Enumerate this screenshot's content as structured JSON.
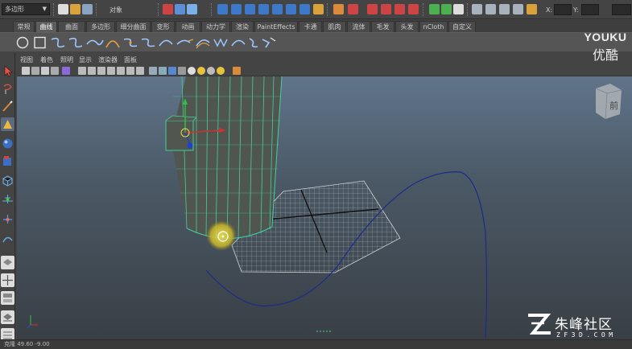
{
  "status_line": {
    "mode_menu": "多边形",
    "object_label": "对象",
    "coord_labels": {
      "x": "X:",
      "y": "Y:"
    },
    "colors": {
      "background": "#444444",
      "field": "#2b2b2b"
    }
  },
  "shelf": {
    "tabs": [
      {
        "label": "常规",
        "active": false
      },
      {
        "label": "曲线",
        "active": true
      },
      {
        "label": "曲面",
        "active": false
      },
      {
        "label": "多边形",
        "active": false
      },
      {
        "label": "细分曲面",
        "active": false
      },
      {
        "label": "变形",
        "active": false
      },
      {
        "label": "动画",
        "active": false
      },
      {
        "label": "动力学",
        "active": false
      },
      {
        "label": "渲染",
        "active": false
      },
      {
        "label": "PaintEffects",
        "active": false
      },
      {
        "label": "卡通",
        "active": false
      },
      {
        "label": "肌肉",
        "active": false
      },
      {
        "label": "流体",
        "active": false
      },
      {
        "label": "毛发",
        "active": false
      },
      {
        "label": "头发",
        "active": false
      },
      {
        "label": "nCloth",
        "active": false
      },
      {
        "label": "自定义",
        "active": false
      }
    ],
    "icons": [
      "circle-curve-icon",
      "square-curve-icon",
      "cv-curve-icon",
      "ep-curve-icon",
      "pencil-curve-icon",
      "arc-tool-icon",
      "attach-curves-icon",
      "detach-curves-icon",
      "insert-knot-icon",
      "extend-curve-icon",
      "offset-curve-icon",
      "rebuild-curve-icon",
      "reverse-curve-icon",
      "fillet-curve-icon",
      "project-curve-icon",
      "loft-icon"
    ]
  },
  "viewport": {
    "menus": [
      "视图",
      "着色",
      "照明",
      "显示",
      "渲染器",
      "面板"
    ],
    "view_cube_label": "前",
    "colors": {
      "bg_top": "#60748a",
      "bg_bottom": "#393f45",
      "mesh": "#4c524a",
      "wire": "#40d0a0",
      "curve": "#1e2a8c",
      "grid": "#cfd3d6"
    }
  },
  "help_line": {
    "text": "克隆  49.60    -9.00"
  },
  "watermarks": {
    "youku_en": "YOUKU",
    "youku_cn": "优酷",
    "zf_title": "朱峰社区",
    "zf_domain": "ZF3D.COM"
  }
}
